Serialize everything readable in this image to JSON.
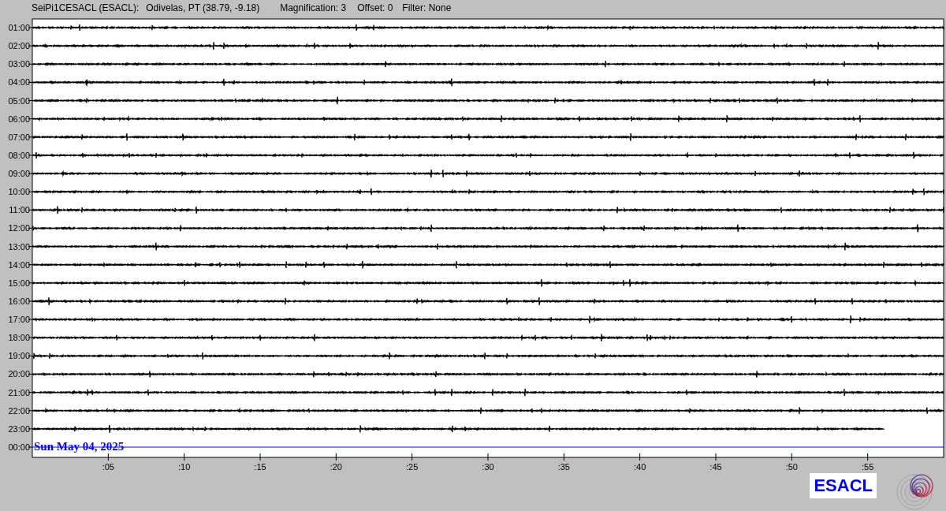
{
  "header": {
    "station": "SeiPi1CESACL (ESACL):",
    "location": "Odivelas, PT (38.79, -9.18)",
    "magnification": "Magnification: 3",
    "offset": "Offset: 0",
    "filter": "Filter: None"
  },
  "rows": [
    {
      "hour": "01:00",
      "kind": "full"
    },
    {
      "hour": "02:00",
      "kind": "full"
    },
    {
      "hour": "03:00",
      "kind": "full"
    },
    {
      "hour": "04:00",
      "kind": "full"
    },
    {
      "hour": "05:00",
      "kind": "full"
    },
    {
      "hour": "06:00",
      "kind": "full"
    },
    {
      "hour": "07:00",
      "kind": "full"
    },
    {
      "hour": "08:00",
      "kind": "full"
    },
    {
      "hour": "09:00",
      "kind": "full"
    },
    {
      "hour": "10:00",
      "kind": "full"
    },
    {
      "hour": "11:00",
      "kind": "full"
    },
    {
      "hour": "12:00",
      "kind": "full"
    },
    {
      "hour": "13:00",
      "kind": "full"
    },
    {
      "hour": "14:00",
      "kind": "full"
    },
    {
      "hour": "15:00",
      "kind": "full"
    },
    {
      "hour": "16:00",
      "kind": "full"
    },
    {
      "hour": "17:00",
      "kind": "full"
    },
    {
      "hour": "18:00",
      "kind": "full"
    },
    {
      "hour": "19:00",
      "kind": "full"
    },
    {
      "hour": "20:00",
      "kind": "full"
    },
    {
      "hour": "21:00",
      "kind": "full"
    },
    {
      "hour": "22:00",
      "kind": "full"
    },
    {
      "hour": "23:00",
      "kind": "partial"
    },
    {
      "hour": "00:00",
      "kind": "current",
      "date": "Sun May 04, 2025"
    }
  ],
  "minute_ticks": [
    ":05",
    ":10",
    ":15",
    ":20",
    ":25",
    ":30",
    ":35",
    ":40",
    ":45",
    ":50",
    ":55"
  ],
  "logo": {
    "text": "ESACL"
  }
}
